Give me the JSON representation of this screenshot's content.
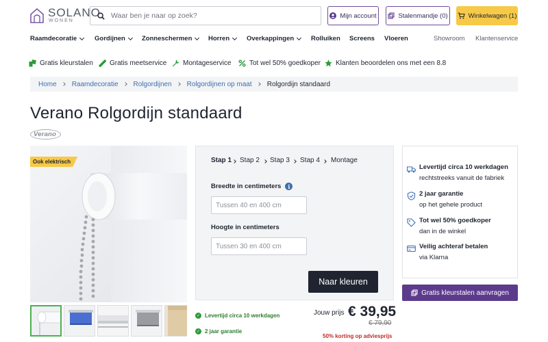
{
  "header": {
    "logo_brand": "SOLANO",
    "logo_sub": "WONEN",
    "search_placeholder": "Waar ben je naar op zoek?",
    "account_label": "Mijn account",
    "stalen_label": "Stalenmandje (0)",
    "cart_label": "Winkelwagen (1)"
  },
  "nav": {
    "items": [
      {
        "label": "Raamdecoratie",
        "has_menu": true
      },
      {
        "label": "Gordijnen",
        "has_menu": true
      },
      {
        "label": "Zonneschermen",
        "has_menu": true
      },
      {
        "label": "Horren",
        "has_menu": true
      },
      {
        "label": "Overkappingen",
        "has_menu": true
      },
      {
        "label": "Rolluiken",
        "has_menu": false
      },
      {
        "label": "Screens",
        "has_menu": false
      },
      {
        "label": "Vloeren",
        "has_menu": false
      }
    ],
    "secondary": [
      "Showroom",
      "Klantenservice"
    ]
  },
  "usps": [
    {
      "icon": "swatches-icon",
      "text": "Gratis kleurstalen"
    },
    {
      "icon": "ruler-icon",
      "text": "Gratis meetservice"
    },
    {
      "icon": "wrench-icon",
      "text": "Montageservice"
    },
    {
      "icon": "percent-icon",
      "text": "Tot wel 50% goedkoper"
    },
    {
      "icon": "star-icon",
      "text": "Klanten beoordelen ons met een 8.8"
    }
  ],
  "breadcrumb": [
    "Home",
    "Raamdecoratie",
    "Rolgordijnen",
    "Rolgordijnen op maat",
    "Rolgordijn standaard"
  ],
  "product": {
    "title": "Verano Rolgordijn standaard",
    "brand_logo": "Verano",
    "badge": "Ook elektrisch"
  },
  "thumbnails": [
    "white",
    "blue",
    "white-closeup",
    "grey",
    "beige"
  ],
  "config": {
    "steps": [
      "Stap 1",
      "Stap 2",
      "Stap 3",
      "Stap 4",
      "Montage"
    ],
    "active_step": 0,
    "width_label": "Breedte in centimeters",
    "width_placeholder": "Tussen 40 en 400 cm",
    "height_label": "Hoogte in centimeters",
    "height_placeholder": "Tussen 30 en 400 cm",
    "cta_label": "Naar kleuren"
  },
  "checks": [
    "Levertijd circa 10 werkdagen",
    "2 jaar garantie"
  ],
  "pricing": {
    "label": "Jouw prijs",
    "price": "€ 39,95",
    "old_price": "€ 79,90",
    "discount": "50% korting op adviesprijs"
  },
  "panel": {
    "items": [
      {
        "icon": "truck-icon",
        "title": "Levertijd circa 10 werkdagen",
        "text": "rechtstreeks vanuit de fabriek"
      },
      {
        "icon": "shield-check-icon",
        "title": "2 jaar garantie",
        "text": "op het gehele product"
      },
      {
        "icon": "tag-icon",
        "title": "Tot wel 50% goedkoper",
        "text": "dan in de winkel"
      },
      {
        "icon": "payment-icon",
        "title": "Veilig achteraf betalen",
        "text": "via Klarna"
      }
    ],
    "button_label": "Gratis kleurstalen aanvragen"
  },
  "colors": {
    "accent_purple": "#5c3b8c",
    "cart_yellow": "#f7c948",
    "cta_dark": "#1f2430",
    "link_blue": "#3d6fb0",
    "success_green": "#2e7d32",
    "discount_red": "#c62828"
  }
}
